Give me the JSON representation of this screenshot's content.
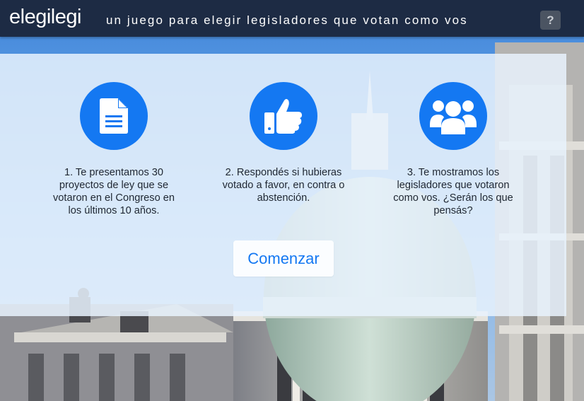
{
  "header": {
    "brand": "elegilegi",
    "tagline": "un juego para elegir legisladores que votan como vos",
    "help_label": "?"
  },
  "steps": [
    {
      "icon": "document-icon",
      "text": "1. Te presentamos 30 proyectos de ley que se votaron en el Congreso en los últimos 10 años."
    },
    {
      "icon": "thumbs-up-icon",
      "text": "2. Respondés si hubieras votado a favor, en contra o abstención."
    },
    {
      "icon": "users-group-icon",
      "text": "3. Te mostramos los legisladores que votaron como vos. ¿Serán los que pensás?"
    }
  ],
  "start_button": {
    "label": "Comenzar"
  },
  "colors": {
    "header_bg": "#1d2b44",
    "accent": "#1478f2",
    "panel_bg": "#e8f2fd",
    "text": "#1f2732"
  }
}
